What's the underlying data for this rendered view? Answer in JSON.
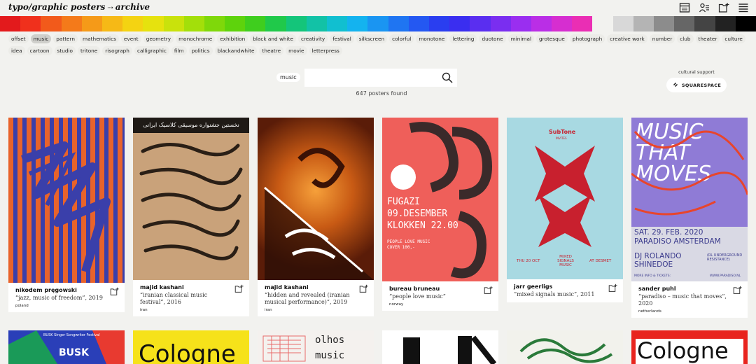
{
  "header": {
    "logo_main": "typo/graphic posters",
    "logo_arrow": "⇢",
    "logo_sub": "archive",
    "icons": [
      "poster-list-icon",
      "designers-icon",
      "add-folder-icon",
      "menu-icon"
    ]
  },
  "palette": [
    "#e31a1c",
    "#f0301c",
    "#f25a1b",
    "#f47a1a",
    "#f59a18",
    "#f6b916",
    "#f4d312",
    "#e6e20e",
    "#c9e20c",
    "#a3df0a",
    "#7fd80a",
    "#5ed30c",
    "#3fce1e",
    "#20c94a",
    "#14c57a",
    "#12c2a6",
    "#11bfd0",
    "#14b3ef",
    "#1a95f2",
    "#1f75f2",
    "#2458f2",
    "#2a3ef0",
    "#3a2ef0",
    "#5a2ef0",
    "#7a2ef0",
    "#9a2ef0",
    "#ba2ee6",
    "#d62ed0",
    "#ea2eb4",
    "#f2f2ef",
    "#d8d8d8",
    "#b4b4b4",
    "#8c8c8c",
    "#666666",
    "#444444",
    "#222222",
    "#000000"
  ],
  "tags_row1": [
    "offset",
    "music",
    "pattern",
    "mathematics",
    "event",
    "geometry",
    "monochrome",
    "exhibition",
    "black and white",
    "creativity",
    "festival",
    "silkscreen",
    "colorful",
    "monotone",
    "lettering",
    "duotone",
    "minimal",
    "grotesque",
    "photograph",
    "creative work",
    "number",
    "club",
    "theater",
    "culture"
  ],
  "tags_row2": [
    "idea",
    "cartoon",
    "studio",
    "tritone",
    "risograph",
    "calligraphic",
    "film",
    "politics",
    "blackandwhite",
    "theatre",
    "movie",
    "letterpress"
  ],
  "search": {
    "chip": "music",
    "placeholder": "",
    "count": "647 posters found"
  },
  "sponsor": {
    "label": "cultural support",
    "name": "SQUARESPACE"
  },
  "posters": [
    {
      "author": "nikodem pręgowski",
      "title": "“jazz, music of freedom”, 2019",
      "country": "poland"
    },
    {
      "author": "majid kashani",
      "title": "“iranian classical music festival”, 2016",
      "country": "iran"
    },
    {
      "author": "majid kashani",
      "title": "“hidden and revealed (iranian musical performance)”, 2019",
      "country": "iran"
    },
    {
      "author": "bureau bruneau",
      "title": "“people love music”",
      "country": "norway"
    },
    {
      "author": "jarr geerligs",
      "title": "“mixed signals music”, 2011",
      "country": ""
    },
    {
      "author": "sander puhl",
      "title": "“paradiso – music that moves”, 2020",
      "country": "netherlands"
    }
  ],
  "poster_text": {
    "p2_header": "نخستین جشنواره موسیقی کلاسیک ایرانی",
    "p4_line1": "FUGAZI",
    "p4_line2": "09.DESEMBER",
    "p4_line3": "KLOKKEN 22.00",
    "p4_line4": "PEOPLE LOVE MUSIC",
    "p4_line5": "COVER 100,-",
    "p5_brand": "SubTone",
    "p5_invites": "INVITES",
    "p5_date": "THU 20 OCT",
    "p5_mid": "MIXED SIGNALS MUSIC",
    "p5_venue": "AT DESMET",
    "p6_title": "MUSIC THAT MOVES",
    "p6_date": "SAT. 29. FEB. 2020",
    "p6_venue": "PARADISO AMSTERDAM",
    "p6_dj": "DJ ROLANDO SHINEDOE",
    "p6_note": "(RL UNDERGROUND RESISTANCE)",
    "p6_more": "MORE INFO & TICKETS:",
    "p6_url": "WWW.PARADISO.NL",
    "row2_b1": "BUSK Singer Songwriter Festival",
    "row2_b1_big": "BUSK",
    "row2_b2": "Cologne",
    "row2_b3a": "olhos",
    "row2_b3b": "music",
    "row2_b6": "Cologne"
  }
}
